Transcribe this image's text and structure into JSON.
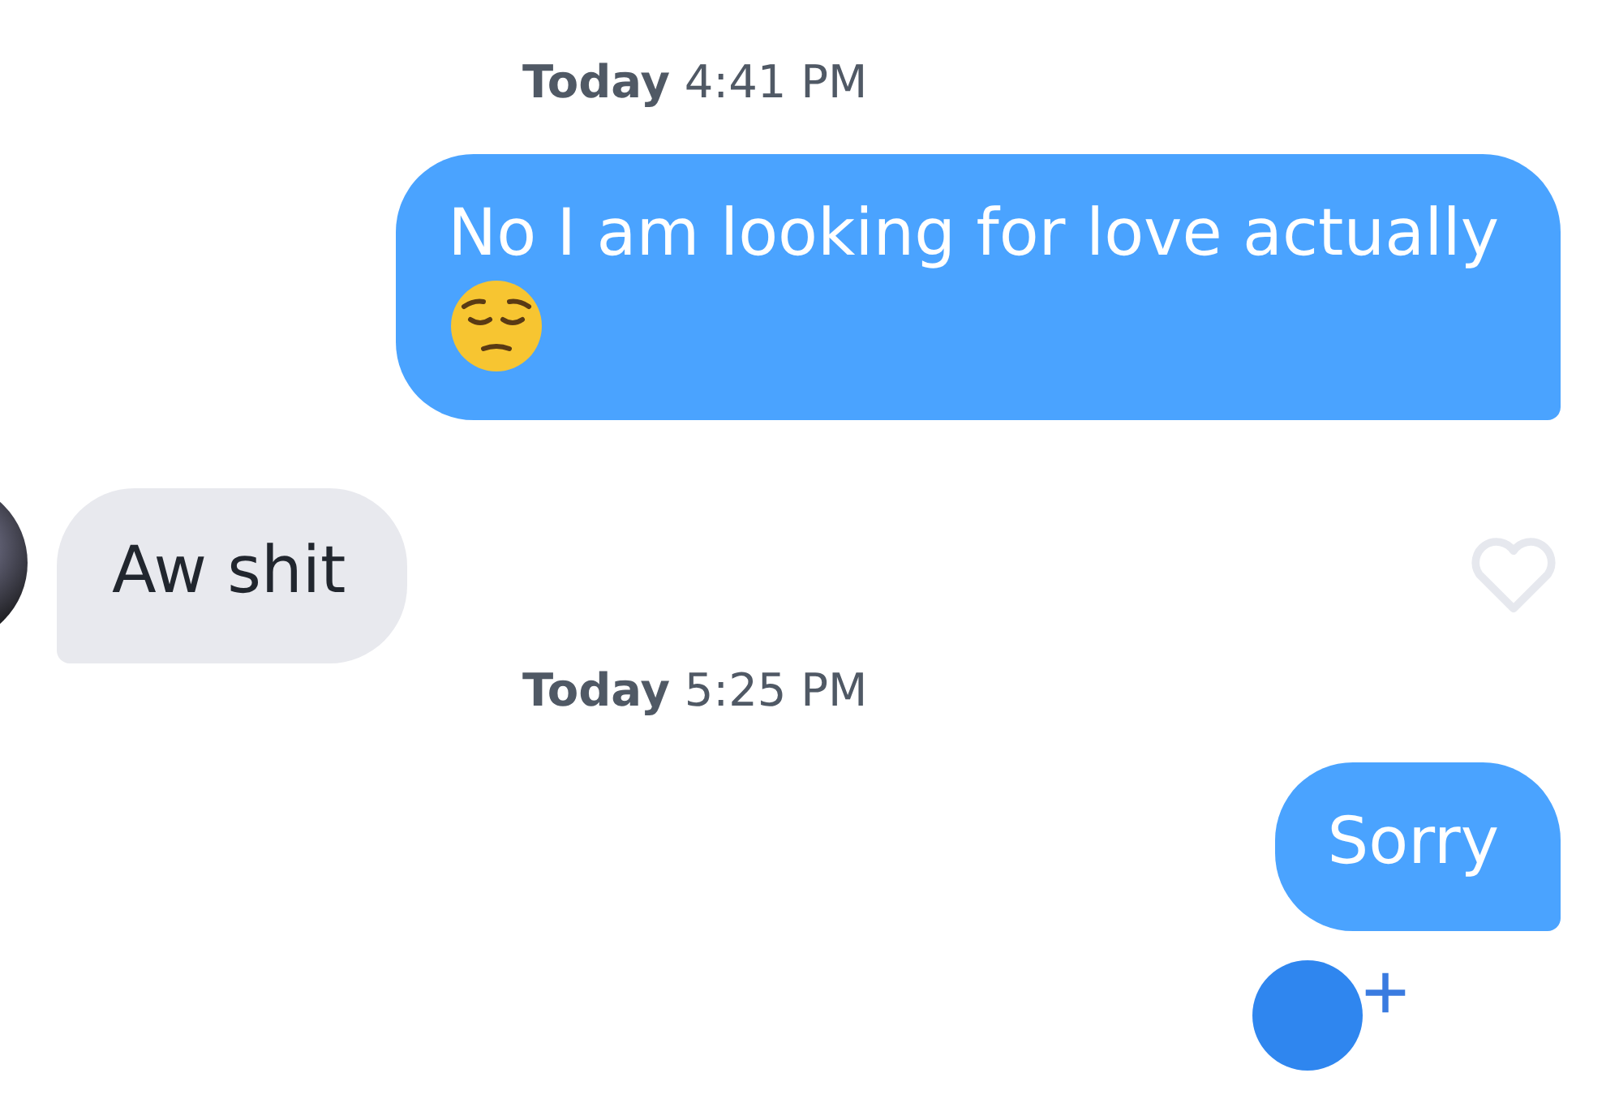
{
  "messages": [
    {
      "kind": "timestamp",
      "text": "**Today** 4:41 PM"
    },
    {
      "kind": "sent",
      "text": "No I am looking for love actually",
      "emoji": true
    },
    {
      "kind": "received",
      "text": "Aw shit",
      "liked": false
    },
    {
      "kind": "timestamp",
      "text": "**Today** 5:25 PM"
    },
    {
      "kind": "sent",
      "text": "Sorry",
      "emoji": false
    }
  ]
}
